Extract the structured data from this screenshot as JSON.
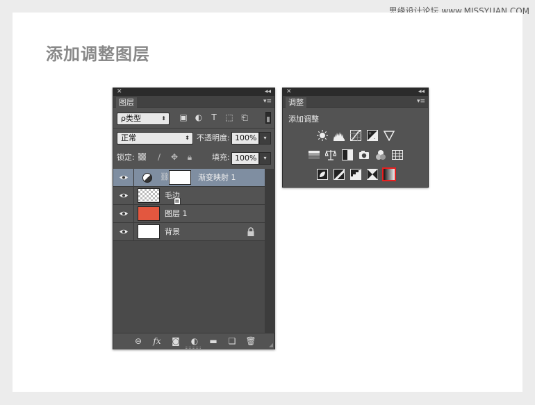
{
  "watermark_top": "思缘设计论坛 www.MISSYUAN.COM",
  "page_title": "添加调整图层",
  "layers_panel": {
    "tab_label": "图层",
    "filter_dropdown": "ρ类型",
    "blend_mode": "正常",
    "opacity_label": "不透明度:",
    "opacity_value": "100%",
    "lock_label": "锁定:",
    "fill_label": "填充:",
    "fill_value": "100%",
    "layers": [
      {
        "name": "渐变映射 1",
        "selected": true
      },
      {
        "name": "毛边"
      },
      {
        "name": "图层 1"
      },
      {
        "name": "背景"
      }
    ]
  },
  "adjust_panel": {
    "tab_label": "调整",
    "heading": "添加调整",
    "row1": [
      "brightness-contrast-icon",
      "levels-icon",
      "curves-icon",
      "exposure-icon",
      "vibrance-icon"
    ],
    "row2": [
      "hue-saturation-icon",
      "color-balance-icon",
      "black-white-icon",
      "photo-filter-icon",
      "channel-mixer-icon",
      "color-lookup-icon"
    ],
    "row3": [
      "invert-icon",
      "posterize-icon",
      "threshold-icon",
      "selective-color-icon",
      "gradient-map-icon"
    ],
    "selected": "gradient-map-icon"
  },
  "colors": {
    "selected_layer": "#7f8ea1",
    "orange_thumb": "#e3573f",
    "highlight": "#e82020"
  }
}
